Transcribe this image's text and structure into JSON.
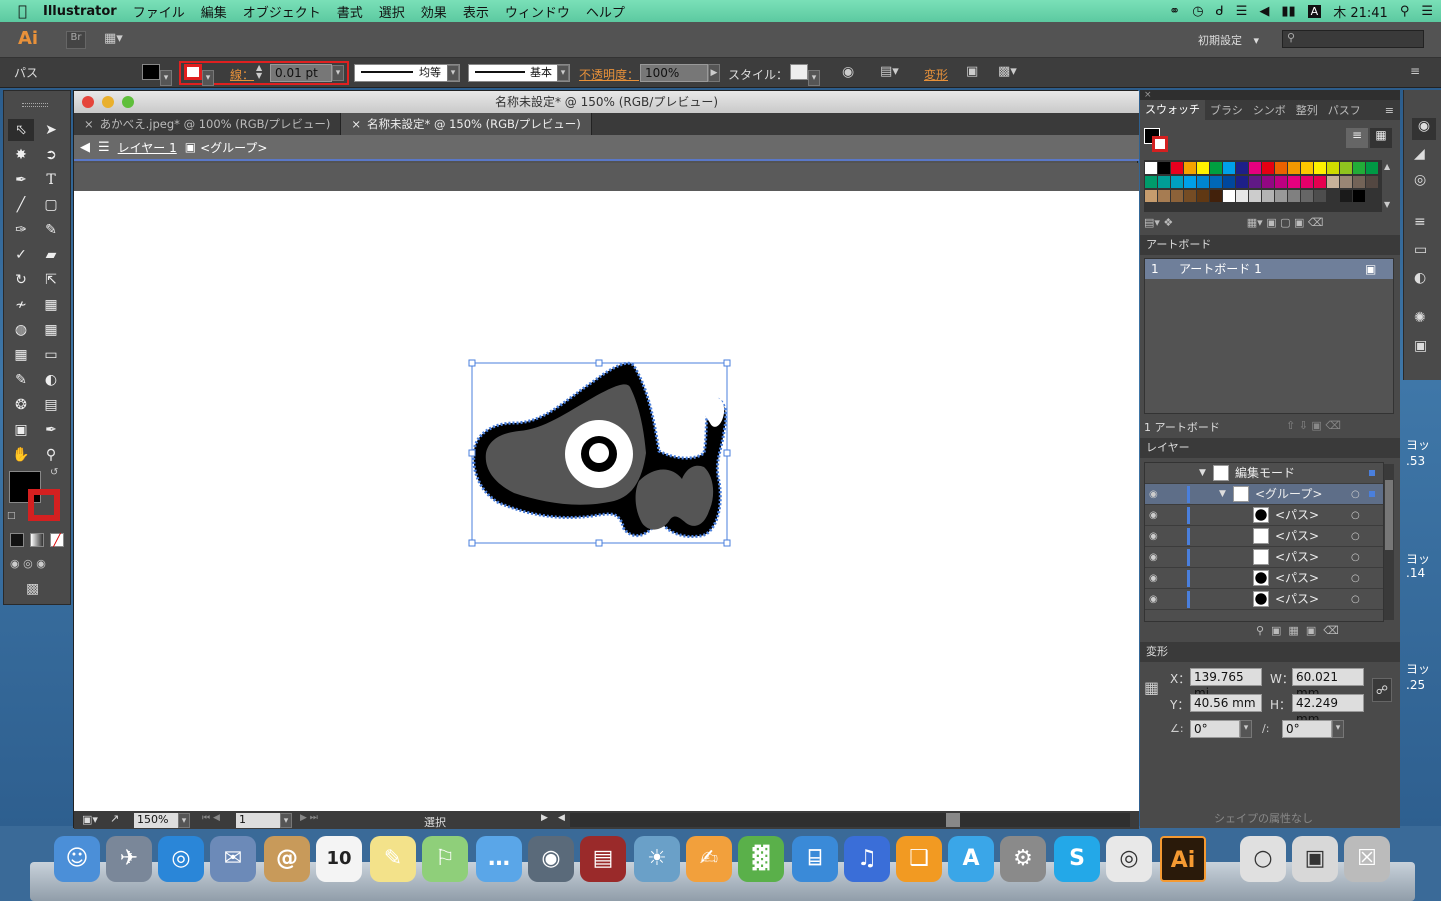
{
  "menubar": {
    "app": "Illustrator",
    "items": [
      "ファイル",
      "編集",
      "オブジェクト",
      "書式",
      "選択",
      "効果",
      "表示",
      "ウィンドウ",
      "ヘルプ"
    ],
    "clock": "木 21:41",
    "input_indicator": "A"
  },
  "appbar": {
    "logo": "Ai",
    "bridge": "Br",
    "workspace": "初期設定",
    "workspace_arrow": "▾",
    "search_placeholder": ""
  },
  "control": {
    "object_label": "パス",
    "stroke_label": "線：",
    "stroke_value": "0.01 pt",
    "profile_label": "均等",
    "brush_label": "基本",
    "opacity_label": "不透明度：",
    "opacity_value": "100%",
    "style_label": "スタイル：",
    "transform_label": "変形"
  },
  "document": {
    "window_title": "名称未設定* @ 150% (RGB/プレビュー)",
    "tabs": [
      {
        "label": "あかべえ.jpeg* @ 100% (RGB/プレビュー)",
        "close": "×"
      },
      {
        "label": "名称未設定* @ 150% (RGB/プレビュー)",
        "close": "×"
      }
    ],
    "breadcrumb_layer": "レイヤー 1",
    "breadcrumb_group": "<グループ>",
    "zoom": "150%",
    "page": "1",
    "status": "選択"
  },
  "swatches_panel": {
    "tabs": [
      "スウォッチ",
      "ブラシ",
      "シンボ",
      "整列",
      "パスフ"
    ],
    "colors": [
      "#ffffff",
      "#000000",
      "#e8001e",
      "#f5a300",
      "#fff100",
      "#00a040",
      "#00a0e9",
      "#1d2088",
      "#e4007f",
      "#e60012",
      "#eb6100",
      "#f39800",
      "#fcc800",
      "#fff100",
      "#cfdb00",
      "#8fc31f",
      "#22ac38",
      "#009944",
      "#009b6b",
      "#009e96",
      "#00a0c1",
      "#00a0e9",
      "#0086d1",
      "#0068b7",
      "#00479d",
      "#1d2088",
      "#601986",
      "#920783",
      "#be0081",
      "#e4007f",
      "#e5006a",
      "#e5004f",
      "#c7b299",
      "#998675",
      "#736357",
      "#534741",
      "#c69c6d",
      "#a67c52",
      "#8c6239",
      "#754c24",
      "#603813",
      "#42210b",
      "#ffffff",
      "#e6e6e6",
      "#cccccc",
      "#b3b3b3",
      "#999999",
      "#808080",
      "#666666",
      "#4d4d4d",
      "#333333",
      "#1a1a1a",
      "#000000"
    ]
  },
  "artboards_panel": {
    "title": "アートボード",
    "rows": [
      {
        "index": "1",
        "name": "アートボード 1"
      }
    ],
    "footer": "1 アートボード"
  },
  "layers_panel": {
    "title": "レイヤー",
    "rows": [
      {
        "name": "編集モード",
        "indent": 0
      },
      {
        "name": "<グループ>",
        "indent": 1
      },
      {
        "name": "<パス>",
        "indent": 2
      },
      {
        "name": "<パス>",
        "indent": 2
      },
      {
        "name": "<パス>",
        "indent": 2
      },
      {
        "name": "<パス>",
        "indent": 2
      },
      {
        "name": "<パス>",
        "indent": 2
      }
    ]
  },
  "transform_panel": {
    "title": "変形",
    "x_label": "X：",
    "x": "139.765 mi",
    "y_label": "Y：",
    "y": "40.56 mm",
    "w_label": "W：",
    "w": "60.021 mm",
    "h_label": "H：",
    "h": "42.249 mm",
    "rotate": "0°",
    "shear": "0°",
    "footer": "シェイプの属性なし"
  },
  "desktop_fragments": [
    "ヨッ",
    ".53",
    "ヨッ",
    ".14",
    "ヨッ",
    ".25"
  ],
  "colors": {
    "accent_orange": "#e8913a",
    "selection_blue": "#4a7fdc",
    "highlight_red": "#e02020"
  },
  "dock": [
    "Finder",
    "Launchpad",
    "Safari",
    "Mail",
    "Contacts",
    "Calendar",
    "Notes",
    "Maps",
    "Messages",
    "FaceTime",
    "Photo Booth",
    "iPhoto",
    "Pages",
    "Numbers",
    "Keynote",
    "iTunes",
    "iBooks",
    "App Store",
    "System Preferences",
    "Skype",
    "Chrome",
    "Illustrator",
    "Quick Look",
    "Preview",
    "Trash"
  ],
  "calendar_day": "10"
}
